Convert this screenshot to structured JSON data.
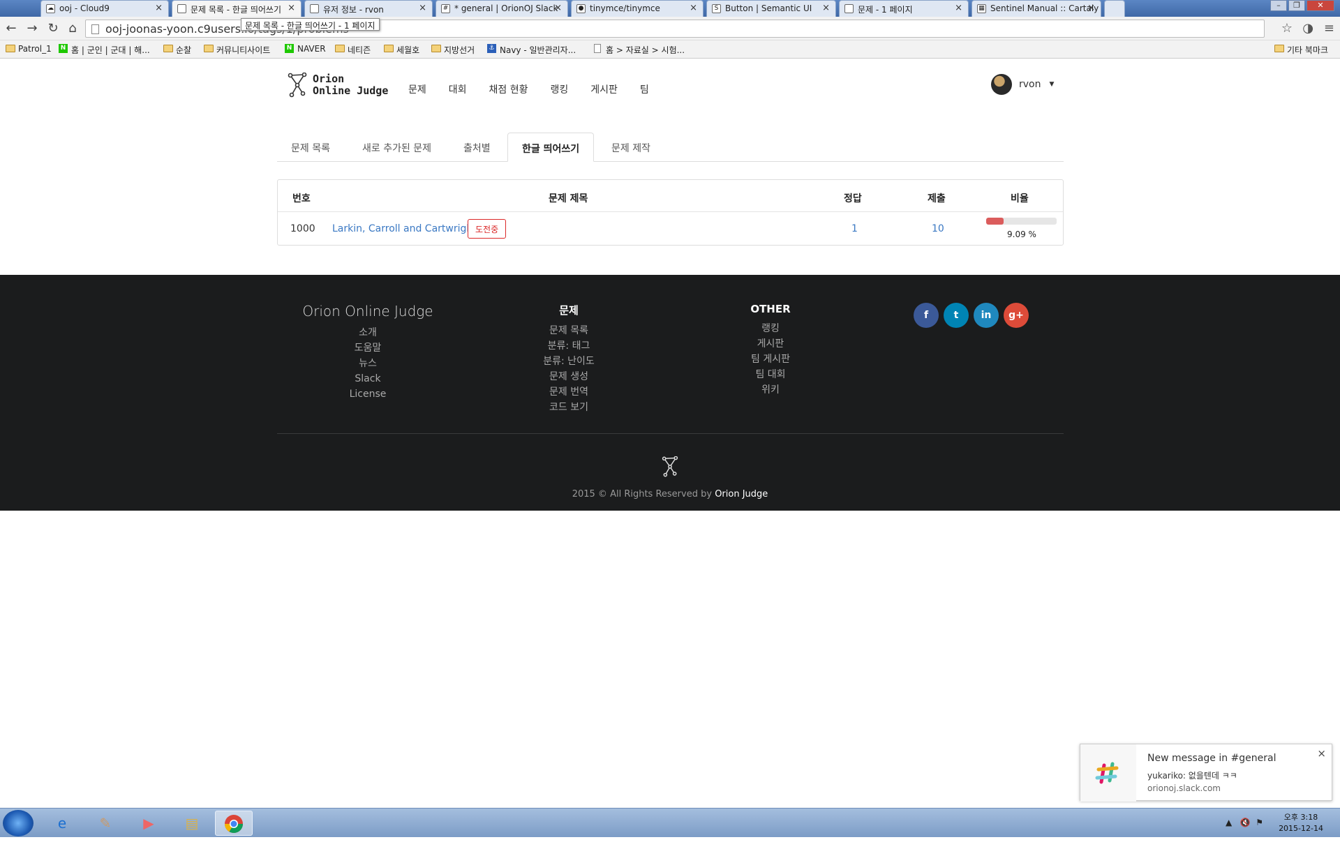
{
  "browser": {
    "tabs": [
      {
        "title": "ooj - Cloud9",
        "icon": "cloud9-icon"
      },
      {
        "title": "문제 목록 - 한글 띄어쓰기",
        "icon": "page-icon",
        "active": true
      },
      {
        "title": "유저 정보 - rvon",
        "icon": "page-icon"
      },
      {
        "title": "* general | OrionOJ Slack",
        "icon": "slack-icon"
      },
      {
        "title": "tinymce/tinymce",
        "icon": "github-icon"
      },
      {
        "title": "Button | Semantic UI",
        "icon": "semantic-icon"
      },
      {
        "title": "문제 - 1 페이지",
        "icon": "page-icon"
      },
      {
        "title": "Sentinel Manual :: Cartaly",
        "icon": "sentinel-icon"
      }
    ],
    "tooltip": "문제 목록 - 한글 띄어쓰기 - 1 페이지",
    "url": "ooj-joonas-yoon.c9users.io/tags/1/problems",
    "bookmarks": [
      "Patrol_1",
      "홈 | 군인 | 군대 | 해...",
      "순찰",
      "커뮤니티사이트",
      "NAVER",
      "네티즌",
      "세월호",
      "지방선거",
      "Navy - 일반관리자...",
      "홈 > 자료실 > 시험..."
    ],
    "other_bookmarks": "기타 북마크"
  },
  "site": {
    "logo_line1": "Orion",
    "logo_line2": "Online Judge",
    "nav": [
      "문제",
      "대회",
      "채점 현황",
      "랭킹",
      "게시판",
      "팀"
    ],
    "user": "rvon"
  },
  "sub_tabs": [
    "문제 목록",
    "새로 추가된 문제",
    "출처별",
    "한글 띄어쓰기",
    "문제 제작"
  ],
  "table": {
    "headers": {
      "number": "번호",
      "title": "문제 제목",
      "correct": "정답",
      "submissions": "제출",
      "ratio": "비율"
    },
    "rows": [
      {
        "number": "1000",
        "title": "Larkin, Carroll and Cartwright",
        "badge": "도전중",
        "correct": "1",
        "submissions": "10",
        "ratio": "9.09 %",
        "ratio_value": 0.0909
      }
    ]
  },
  "footer": {
    "brand": "Orion Online Judge",
    "brand_links": [
      "소개",
      "도움말",
      "뉴스",
      "Slack",
      "License"
    ],
    "problems_title": "문제",
    "problems_links": [
      "문제 목록",
      "분류: 태그",
      "분류: 난이도",
      "문제 생성",
      "문제 번역",
      "코드 보기"
    ],
    "other_title": "OTHER",
    "other_links": [
      "랭킹",
      "게시판",
      "팀 게시판",
      "팀 대회",
      "위키"
    ],
    "social": [
      {
        "name": "facebook-icon",
        "glyph": "f",
        "color": "#3b5998"
      },
      {
        "name": "twitter-icon",
        "glyph": "t",
        "color": "#0084b4"
      },
      {
        "name": "linkedin-icon",
        "glyph": "in",
        "color": "#1f88be"
      },
      {
        "name": "google-plus-icon",
        "glyph": "g+",
        "color": "#dd4b39"
      }
    ],
    "copyright_prefix": "2015 © All Rights Reserved by",
    "copyright_brand": "Orion Judge"
  },
  "notification": {
    "title": "New message in #general",
    "message": "yukariko: 없을텐데 ㅋㅋ",
    "source": "orionoj.slack.com",
    "close": "×"
  },
  "taskbar": {
    "time": "오후 3:18",
    "date": "2015-12-14"
  }
}
